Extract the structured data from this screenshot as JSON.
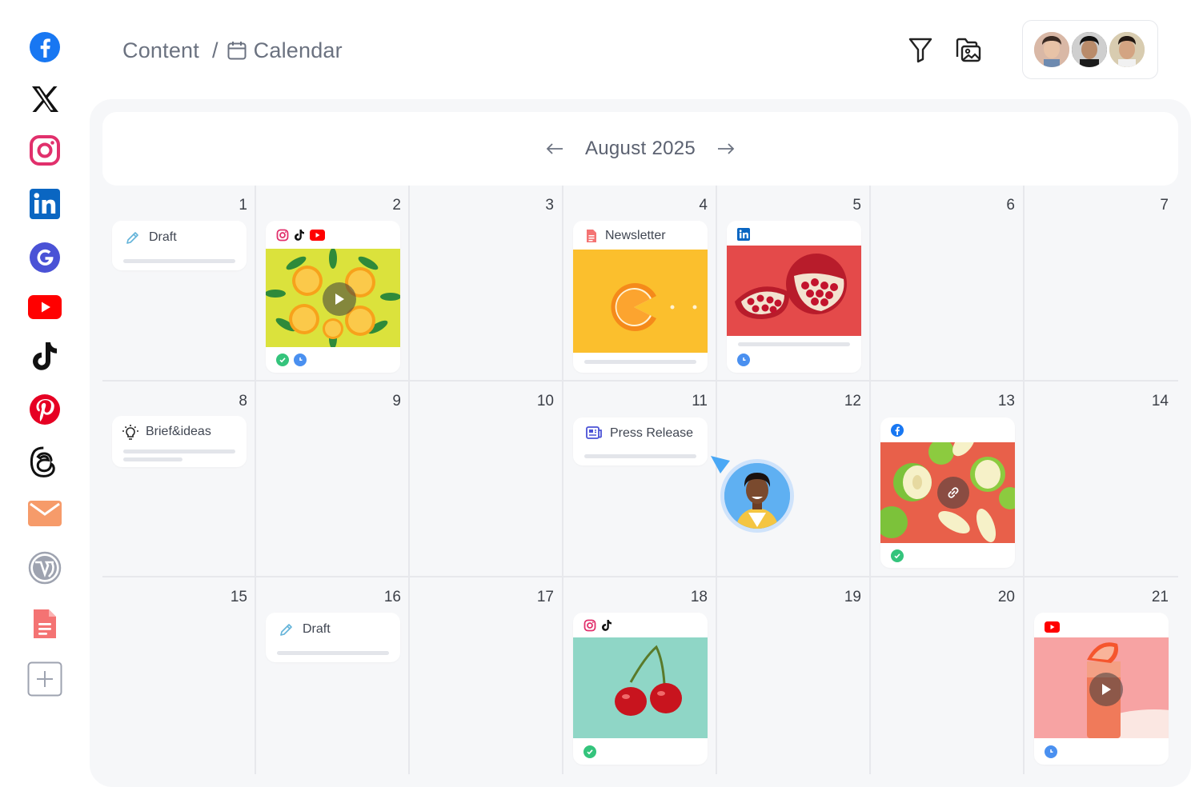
{
  "sidebar": {
    "items": [
      {
        "name": "facebook-icon"
      },
      {
        "name": "x-icon"
      },
      {
        "name": "instagram-icon"
      },
      {
        "name": "linkedin-icon"
      },
      {
        "name": "google-icon"
      },
      {
        "name": "youtube-icon"
      },
      {
        "name": "tiktok-icon"
      },
      {
        "name": "pinterest-icon"
      },
      {
        "name": "threads-icon"
      },
      {
        "name": "email-icon"
      },
      {
        "name": "wordpress-icon"
      },
      {
        "name": "document-icon"
      },
      {
        "name": "add-icon"
      }
    ]
  },
  "header": {
    "breadcrumb_root": "Content",
    "breadcrumb_sep": "/",
    "breadcrumb_current": "Calendar",
    "filter_icon": "filter-icon",
    "media_icon": "media-folder-icon"
  },
  "calendar": {
    "month_title": "August 2025",
    "days": [
      "1",
      "2",
      "3",
      "4",
      "5",
      "6",
      "7",
      "8",
      "9",
      "10",
      "11",
      "12",
      "13",
      "14",
      "15",
      "16",
      "17",
      "18",
      "19",
      "20",
      "21"
    ]
  },
  "cards": {
    "draft_1": {
      "label": "Draft"
    },
    "brief_8": {
      "label": "Brief&ideas"
    },
    "newsletter_4": {
      "label": "Newsletter"
    },
    "press_11": {
      "label": "Press Release"
    },
    "draft_16": {
      "label": "Draft"
    }
  },
  "colors": {
    "panel_bg": "#f6f7f9",
    "approved": "#34c47c",
    "scheduled": "#4a90f0",
    "facebook": "#1877f2",
    "instagram": "#e1306c",
    "youtube": "#ff0000",
    "linkedin": "#0a66c2"
  }
}
